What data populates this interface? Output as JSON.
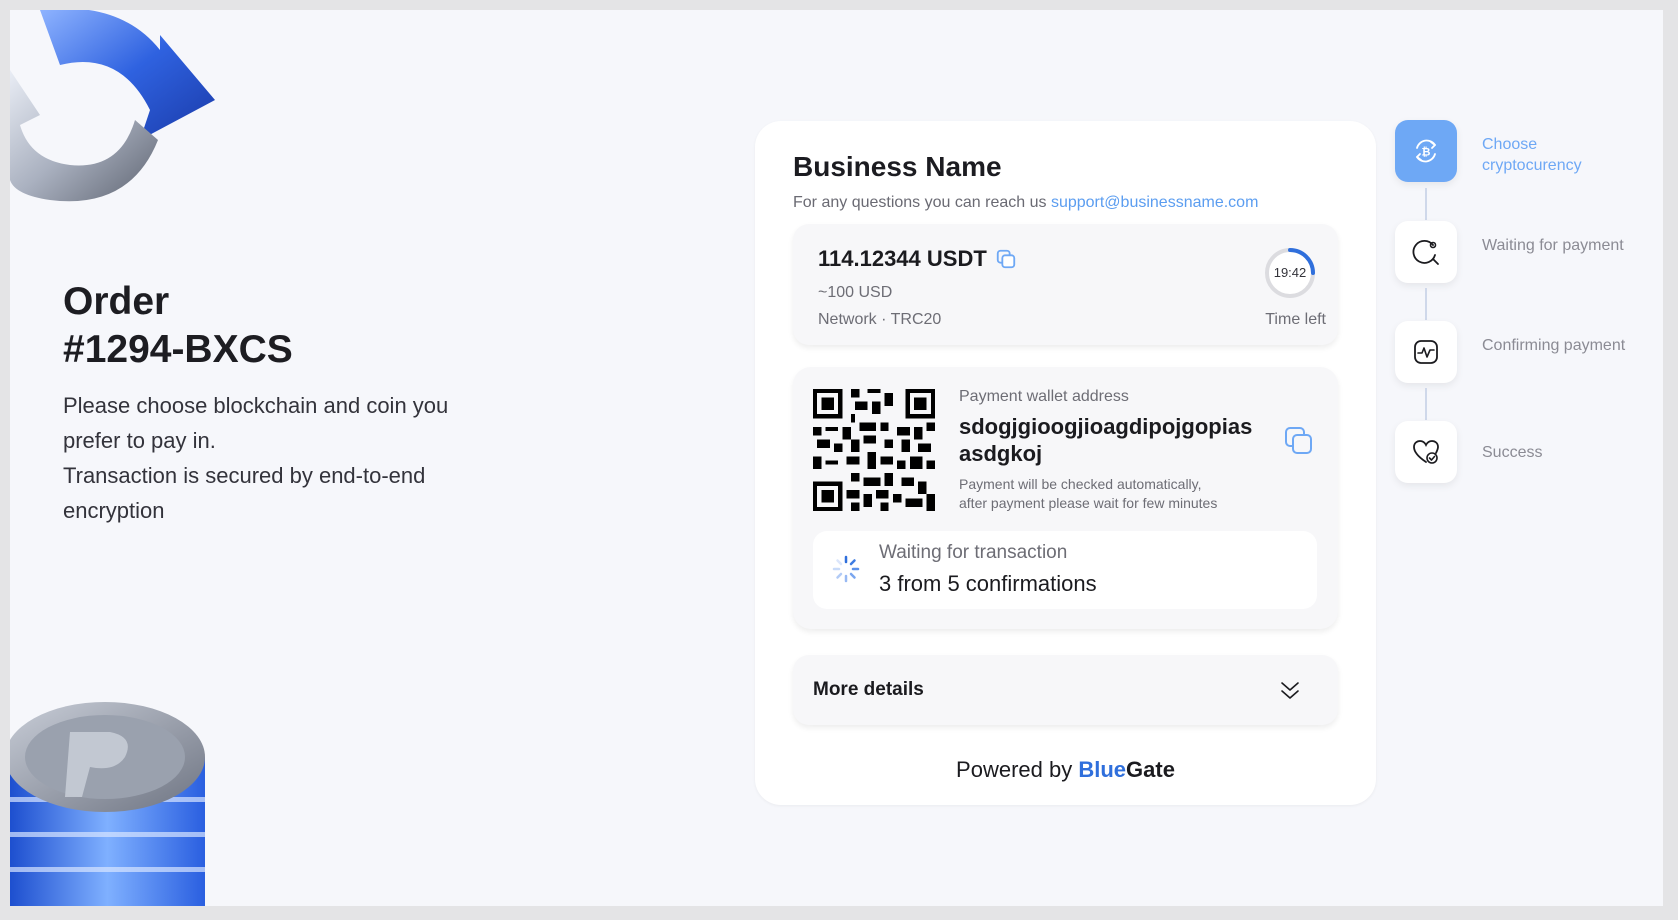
{
  "order": {
    "title_line1": "Order",
    "title_line2": "#1294-BXCS",
    "description_line1": "Please choose blockchain and coin you prefer to pay in.",
    "description_line2": "Transaction is secured by end-to-end encryption"
  },
  "business": {
    "name": "Business Name",
    "contact_text": "For any questions you can reach us",
    "contact_email": "support@businessname.com"
  },
  "amount": {
    "value": "114.12344 USDT",
    "usd_equivalent": "~100 USD",
    "network": "Network · TRC20",
    "timer": "19:42",
    "timer_label": "Time left"
  },
  "payment": {
    "wallet_label": "Payment wallet address",
    "wallet_address": "sdogjgioogjioagdipojgopias asdgkoj",
    "note_line1": "Payment will be checked automatically,",
    "note_line2": "after payment please wait for few minutes",
    "status_label": "Waiting for transaction",
    "status_value": "3 from 5 confirmations"
  },
  "details": {
    "label": "More details"
  },
  "powered": {
    "prefix": "Powered by",
    "brand_part1": "Blue",
    "brand_part2": "Gate"
  },
  "steps": [
    {
      "label": "Choose cryptocurency",
      "icon": "bitcoin-exchange-icon",
      "active": true
    },
    {
      "label": "Waiting for payment",
      "icon": "search-pending-icon",
      "active": false
    },
    {
      "label": "Confirming payment",
      "icon": "pulse-chart-icon",
      "active": false
    },
    {
      "label": "Success",
      "icon": "heart-check-icon",
      "active": false
    }
  ],
  "colors": {
    "accent": "#6ea8f5",
    "brand_blue": "#2f6fdc",
    "link": "#5b9df0"
  }
}
